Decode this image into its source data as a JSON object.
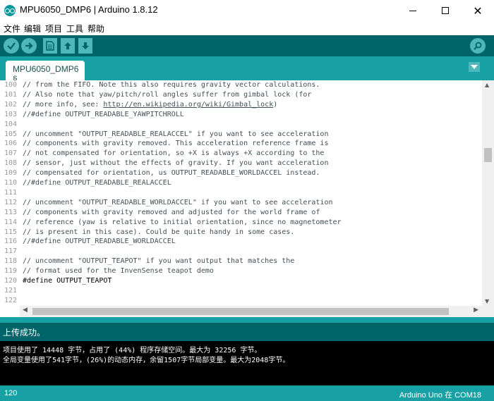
{
  "window": {
    "title": "MPU6050_DMP6 | Arduino 1.8.12",
    "minimize": "—",
    "maximize": "☐",
    "close": "✕"
  },
  "menu": [
    "文件",
    "编辑",
    "项目",
    "工具",
    "帮助"
  ],
  "toolbar": {
    "icons": [
      "verify-icon",
      "upload-icon",
      "new-icon",
      "open-icon",
      "save-icon",
      "serial-monitor-icon"
    ]
  },
  "tabs": [
    {
      "label": "MPU6050_DMP6 §"
    }
  ],
  "editor": {
    "lines": [
      {
        "n": "100",
        "text": "// from the FIFO. Note this also requires gravity vector calculations."
      },
      {
        "n": "101",
        "text": "// Also note that yaw/pitch/roll angles suffer from gimbal lock (for"
      },
      {
        "n": "102",
        "text": "// more info, see: ",
        "link": "http://en.wikipedia.org/wiki/Gimbal_lock",
        "after": ")"
      },
      {
        "n": "103",
        "text": "//#define OUTPUT_READABLE_YAWPITCHROLL"
      },
      {
        "n": "104",
        "text": ""
      },
      {
        "n": "105",
        "text": "// uncomment \"OUTPUT_READABLE_REALACCEL\" if you want to see acceleration"
      },
      {
        "n": "106",
        "text": "// components with gravity removed. This acceleration reference frame is"
      },
      {
        "n": "107",
        "text": "// not compensated for orientation, so +X is always +X according to the"
      },
      {
        "n": "108",
        "text": "// sensor, just without the effects of gravity. If you want acceleration"
      },
      {
        "n": "109",
        "text": "// compensated for orientation, us OUTPUT_READABLE_WORLDACCEL instead."
      },
      {
        "n": "110",
        "text": "//#define OUTPUT_READABLE_REALACCEL"
      },
      {
        "n": "111",
        "text": ""
      },
      {
        "n": "112",
        "text": "// uncomment \"OUTPUT_READABLE_WORLDACCEL\" if you want to see acceleration"
      },
      {
        "n": "113",
        "text": "// components with gravity removed and adjusted for the world frame of"
      },
      {
        "n": "114",
        "text": "// reference (yaw is relative to initial orientation, since no magnetometer"
      },
      {
        "n": "115",
        "text": "// is present in this case). Could be quite handy in some cases."
      },
      {
        "n": "116",
        "text": "//#define OUTPUT_READABLE_WORLDACCEL"
      },
      {
        "n": "117",
        "text": ""
      },
      {
        "n": "118",
        "text": "// uncomment \"OUTPUT_TEAPOT\" if you want output that matches the"
      },
      {
        "n": "119",
        "text": "// format used for the InvenSense teapot demo"
      },
      {
        "n": "120",
        "text": "#define OUTPUT_TEAPOT",
        "directive": true
      },
      {
        "n": "121",
        "text": ""
      },
      {
        "n": "122",
        "text": ""
      }
    ]
  },
  "status": {
    "message": "上传成功。"
  },
  "console": {
    "lines": [
      "项目使用了 14448 字节，占用了 (44%) 程序存储空间。最大为 32256 字节。",
      "全局变量使用了541字节，(26%)的动态内存，余留1507字节局部变量。最大为2048字节。"
    ]
  },
  "footer": {
    "line": "120",
    "board": "Arduino Uno 在 COM18"
  },
  "colors": {
    "toolbar": "#006468",
    "tabbar": "#17a1a5",
    "button": "#4db7bb"
  }
}
